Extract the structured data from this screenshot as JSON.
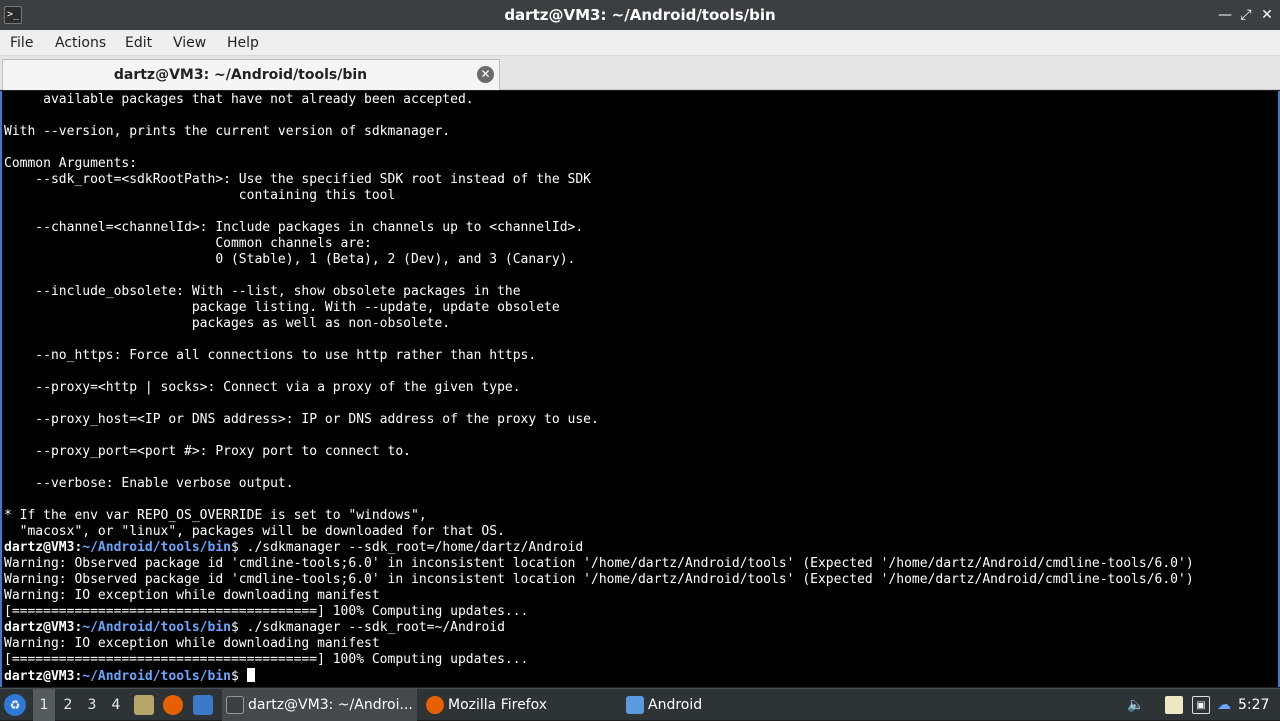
{
  "window": {
    "title": "dartz@VM3: ~/Android/tools/bin",
    "app_icon_text": ">_"
  },
  "menu": [
    "File",
    "Actions",
    "Edit",
    "View",
    "Help"
  ],
  "tab": {
    "label": "dartz@VM3: ~/Android/tools/bin"
  },
  "terminal": {
    "prompt_user": "dartz@VM3:",
    "prompt_path": "~/Android/tools/bin",
    "lines": [
      "     available packages that have not already been accepted.",
      "",
      "With --version, prints the current version of sdkmanager.",
      "",
      "Common Arguments:",
      "    --sdk_root=<sdkRootPath>: Use the specified SDK root instead of the SDK",
      "                              containing this tool",
      "",
      "    --channel=<channelId>: Include packages in channels up to <channelId>.",
      "                           Common channels are:",
      "                           0 (Stable), 1 (Beta), 2 (Dev), and 3 (Canary).",
      "",
      "    --include_obsolete: With --list, show obsolete packages in the",
      "                        package listing. With --update, update obsolete",
      "                        packages as well as non-obsolete.",
      "",
      "    --no_https: Force all connections to use http rather than https.",
      "",
      "    --proxy=<http | socks>: Connect via a proxy of the given type.",
      "",
      "    --proxy_host=<IP or DNS address>: IP or DNS address of the proxy to use.",
      "",
      "    --proxy_port=<port #>: Proxy port to connect to.",
      "",
      "    --verbose: Enable verbose output.",
      "",
      "* If the env var REPO_OS_OVERRIDE is set to \"windows\",",
      "  \"macosx\", or \"linux\", packages will be downloaded for that OS."
    ],
    "cmd1": " ./sdkmanager --sdk_root=/home/dartz/Android",
    "out1": [
      "Warning: Observed package id 'cmdline-tools;6.0' in inconsistent location '/home/dartz/Android/tools' (Expected '/home/dartz/Android/cmdline-tools/6.0')",
      "Warning: Observed package id 'cmdline-tools;6.0' in inconsistent location '/home/dartz/Android/tools' (Expected '/home/dartz/Android/cmdline-tools/6.0')",
      "Warning: IO exception while downloading manifest",
      "[=======================================] 100% Computing updates..."
    ],
    "cmd2": " ./sdkmanager --sdk_root=~/Android",
    "out2": [
      "Warning: IO exception while downloading manifest",
      "[=======================================] 100% Computing updates..."
    ],
    "cmd3": " "
  },
  "taskbar": {
    "workspaces": [
      "1",
      "2",
      "3",
      "4"
    ],
    "tasks": [
      {
        "label": "dartz@VM3: ~/Androi...",
        "icon": "terminal-icon",
        "color": "#3b3f42"
      },
      {
        "label": "Mozilla Firefox",
        "icon": "firefox-icon",
        "color": "#e66000"
      },
      {
        "label": "Android",
        "icon": "folder-icon",
        "color": "#5a9be0"
      }
    ],
    "clock": "5:27"
  },
  "colors": {
    "accent": "#3d7cc9",
    "prompt_path": "#6aa6ff"
  }
}
